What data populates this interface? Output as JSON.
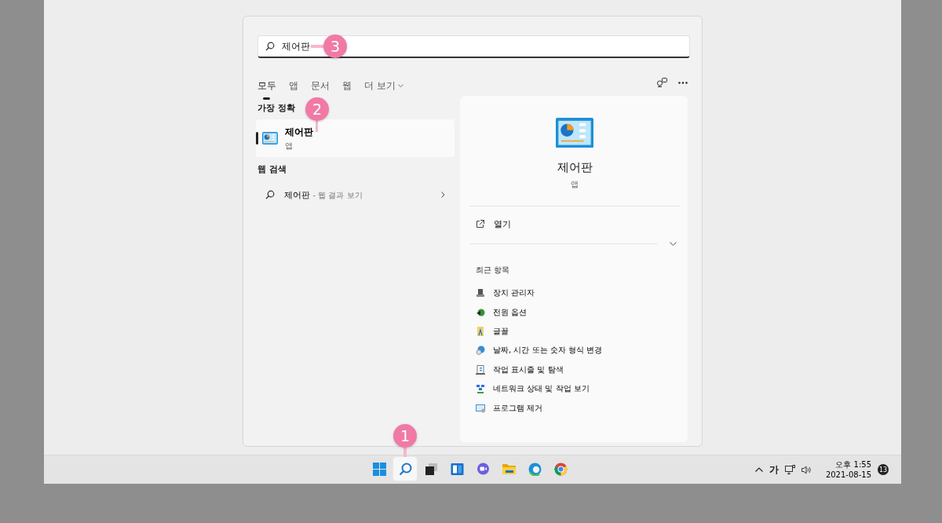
{
  "search": {
    "value": "제어판",
    "callout": "3"
  },
  "filters": [
    {
      "label": "모두",
      "selected": true
    },
    {
      "label": "앱",
      "selected": false
    },
    {
      "label": "문서",
      "selected": false
    },
    {
      "label": "웹",
      "selected": false
    },
    {
      "label": "더 보기",
      "selected": false
    }
  ],
  "best_match": {
    "heading": "가장 정확",
    "item": {
      "title": "제어판",
      "subtitle": "앱",
      "selected": true,
      "callout": "2"
    }
  },
  "web_search": {
    "heading": "웹 검색",
    "item": {
      "query": "제어판",
      "suffix": "- 웹 결과 보기"
    }
  },
  "preview": {
    "title": "제어판",
    "subtitle": "앱",
    "action": "열기",
    "recent_heading": "최근 항목",
    "recent": [
      {
        "label": "장치 관리자",
        "kind": "device"
      },
      {
        "label": "전원 옵션",
        "kind": "power"
      },
      {
        "label": "글꼴",
        "kind": "font"
      },
      {
        "label": "날짜, 시간 또는 숫자 형식 변경",
        "kind": "clock"
      },
      {
        "label": "작업 표시줄 및 탐색",
        "kind": "taskbar"
      },
      {
        "label": "네트워크 상태 및 작업 보기",
        "kind": "network"
      },
      {
        "label": "프로그램 제거",
        "kind": "programs"
      }
    ]
  },
  "taskbar": {
    "apps": [
      {
        "kind": "start",
        "selected": false
      },
      {
        "kind": "search",
        "selected": true,
        "callout": "1"
      },
      {
        "kind": "taskview",
        "selected": false
      },
      {
        "kind": "widgets",
        "selected": false
      },
      {
        "kind": "chat",
        "selected": false
      },
      {
        "kind": "explorer",
        "selected": false
      },
      {
        "kind": "edge",
        "selected": false
      },
      {
        "kind": "chrome",
        "selected": false
      }
    ],
    "ime": "가",
    "time": "오후 1:55",
    "date": "2021-08-15",
    "badge": "13"
  }
}
